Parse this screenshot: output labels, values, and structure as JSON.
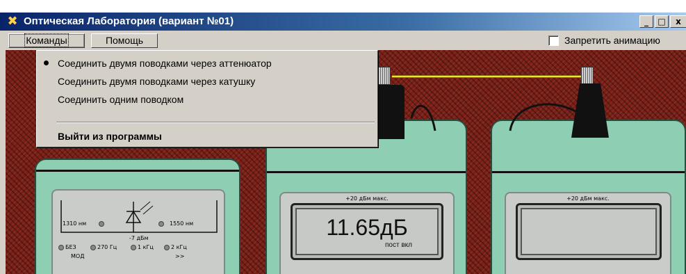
{
  "window": {
    "title": "Оптическая Лаборатория (вариант №01)",
    "icon": "app-cross-icon",
    "controls": {
      "minimize": "_",
      "maximize": "□",
      "close": "x"
    }
  },
  "menubar": {
    "commands_label": "Команды",
    "help_label": "Помощь",
    "disable_animation_label": "Запретить анимацию",
    "disable_animation_checked": false
  },
  "dropdown": {
    "items": [
      {
        "label": "Соединить двумя поводками через аттенюатор",
        "selected": true
      },
      {
        "label": "Соединить двумя поводками через катушку",
        "selected": false
      },
      {
        "label": "Соединить одним поводком",
        "selected": false
      }
    ],
    "exit_label": "Выйти из программы"
  },
  "source": {
    "wl_left": "1310 нм",
    "wl_right": "1550 нм",
    "power": "-7 дБм",
    "modes": [
      "БЕЗ",
      "270 Гц",
      "1 кГц",
      "2 кГц"
    ],
    "bottom_left": "МОД",
    "bottom_right": ">>"
  },
  "meter1": {
    "max_label": "+20 дБм макс.",
    "value": "11.65дБ",
    "sub": "пост вкл"
  },
  "meter2": {
    "max_label": "+20 дБм макс."
  },
  "colors": {
    "titlebar_start": "#0a246a",
    "titlebar_end": "#a6caf0",
    "device": "#8ecfb3",
    "background": "#7a1f16",
    "fiber": "#f2e51d"
  }
}
